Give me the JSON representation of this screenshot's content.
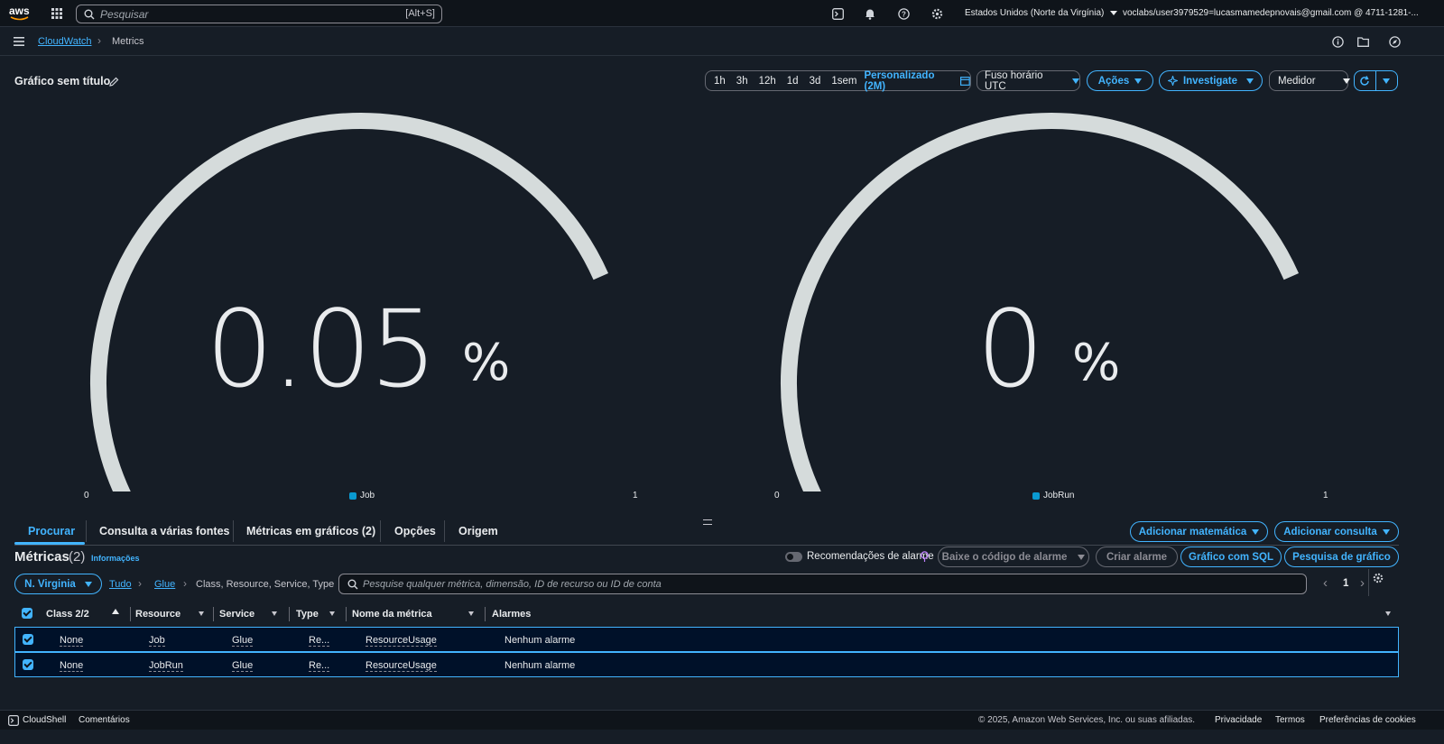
{
  "topnav": {
    "logo": "aws",
    "search_placeholder": "Pesquisar",
    "search_shortcut": "[Alt+S]",
    "region": "Estados Unidos (Norte da Virgínia)",
    "account": "voclabs/user3979529=lucasmamedepnovais@gmail.com @ 4711-1281-..."
  },
  "breadcrumb": {
    "service": "CloudWatch",
    "page": "Metrics"
  },
  "graph": {
    "title": "Gráfico sem título",
    "time_ranges": [
      "1h",
      "3h",
      "12h",
      "1d",
      "3d",
      "1sem"
    ],
    "custom_range": "Personalizado (2M)",
    "timezone": "Fuso horário UTC",
    "actions": "Ações",
    "investigate": "Investigate",
    "widget_type": "Medidor"
  },
  "gauges": [
    {
      "value": "0.05",
      "unit": "%",
      "min": "0",
      "max": "1",
      "legend": "Job",
      "fill_fraction": 0.05
    },
    {
      "value": "0",
      "unit": "%",
      "min": "0",
      "max": "1",
      "legend": "JobRun",
      "fill_fraction": 0
    }
  ],
  "colors": {
    "accent": "#42b4ff",
    "series": "#0a9ad1",
    "gauge_track": "#d5dbdb"
  },
  "tabs": [
    "Procurar",
    "Consulta a várias fontes",
    "Métricas em gráficos (2)",
    "Opções",
    "Origem"
  ],
  "tab_actions": {
    "add_math": "Adicionar matemática",
    "add_query": "Adicionar consulta"
  },
  "metrics": {
    "title": "Métricas",
    "count": "(2)",
    "info": "Informações",
    "alarm_recommendations": "Recomendações de alarme",
    "download_alarm_code": "Baixe o código de alarme",
    "create_alarm": "Criar alarme",
    "graph_sql": "Gráfico com SQL",
    "graph_search": "Pesquisa de gráfico",
    "region_filter": "N. Virginia",
    "crumb_all": "Tudo",
    "crumb_glue": "Glue",
    "crumb_dims": "Class, Resource, Service, Type",
    "search_placeholder": "Pesquise qualquer métrica, dimensão, ID de recurso ou ID de conta",
    "page": "1"
  },
  "table": {
    "columns": [
      "Class 2/2",
      "Resource",
      "Service",
      "Type",
      "Nome da métrica",
      "Alarmes"
    ],
    "rows": [
      [
        "None",
        "Job",
        "Glue",
        "Re...",
        "ResourceUsage",
        "Nenhum alarme"
      ],
      [
        "None",
        "JobRun",
        "Glue",
        "Re...",
        "ResourceUsage",
        "Nenhum alarme"
      ]
    ]
  },
  "footer": {
    "cloudshell": "CloudShell",
    "feedback": "Comentários",
    "copyright": "© 2025, Amazon Web Services, Inc. ou suas afiliadas.",
    "privacy": "Privacidade",
    "terms": "Termos",
    "cookies": "Preferências de cookies"
  }
}
